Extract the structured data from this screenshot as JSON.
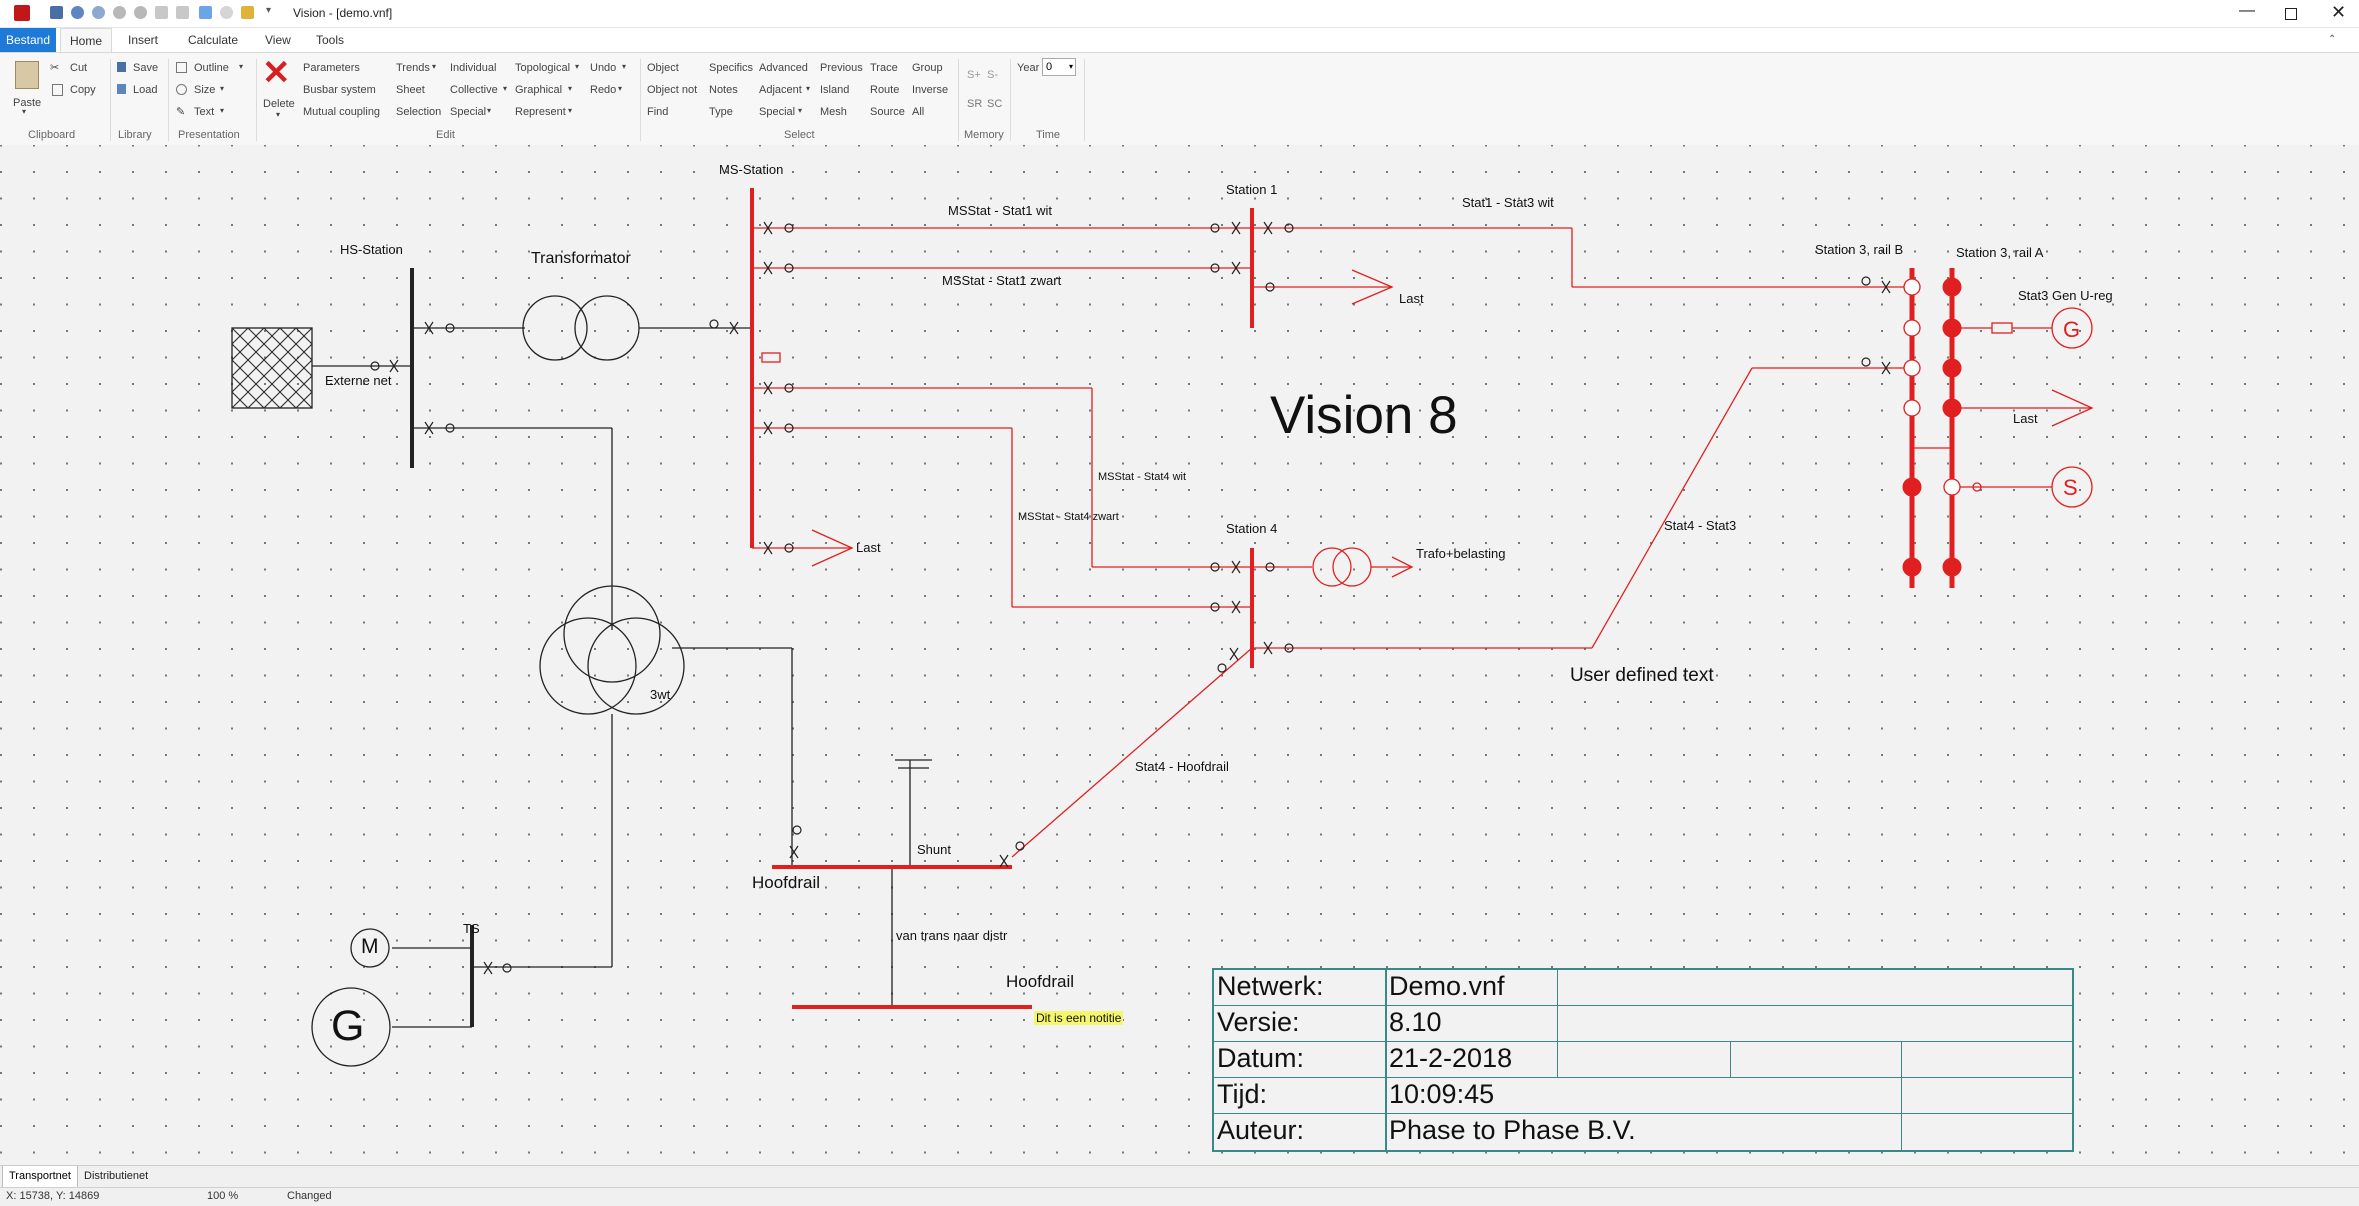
{
  "window": {
    "title": "Vision - [demo.vnf]"
  },
  "tabs": [
    "Bestand",
    "Home",
    "Insert",
    "Calculate",
    "View",
    "Tools"
  ],
  "ribbon": {
    "clipboard": {
      "paste": "Paste",
      "cut": "Cut",
      "copy": "Copy",
      "label": "Clipboard"
    },
    "library": {
      "save": "Save",
      "load": "Load",
      "label": "Library"
    },
    "presentation": {
      "outline": "Outline",
      "size": "Size",
      "text": "Text",
      "label": "Presentation"
    },
    "edit": {
      "delete": "Delete",
      "parameters": "Parameters",
      "busbar": "Busbar system",
      "mutual": "Mutual coupling",
      "trends": "Trends",
      "sheet": "Sheet",
      "selection": "Selection",
      "individual": "Individual",
      "collective": "Collective",
      "special": "Special",
      "topological": "Topological",
      "graphical": "Graphical",
      "represent": "Represent",
      "undo": "Undo",
      "redo": "Redo",
      "label": "Edit"
    },
    "select": {
      "object": "Object",
      "objectnot": "Object not",
      "find": "Find",
      "specifics": "Specifics",
      "notes": "Notes",
      "type": "Type",
      "advanced": "Advanced",
      "adjacent": "Adjacent",
      "special": "Special",
      "previous": "Previous",
      "island": "Island",
      "mesh": "Mesh",
      "trace": "Trace",
      "route": "Route",
      "source": "Source",
      "group": "Group",
      "inverse": "Inverse",
      "all": "All",
      "label": "Select"
    },
    "memory": {
      "splus": "S+",
      "sminus": "S-",
      "sr": "SR",
      "sc": "SC",
      "label": "Memory"
    },
    "time": {
      "year": "Year",
      "year_value": "0",
      "label": "Time"
    }
  },
  "diagram": {
    "labels": {
      "ms_station": "MS-Station",
      "hs_station": "HS-Station",
      "transformator": "Transformator",
      "externe_net": "Externe net",
      "station1": "Station 1",
      "station4": "Station 4",
      "stat1_stat3": "Stat1 - Stat3 wit",
      "station3b": "Station 3, rail B",
      "station3a": "Station 3, rail A",
      "gen_ureg": "Stat3 Gen U-reg",
      "mss_s1_wit": "MSStat - Stat1 wit",
      "mss_s1_zwart": "MSStat - Stat1 zwart",
      "last": "Last",
      "vision": "Vision 8",
      "mss_s4_wit": "MSStat - Stat4 wit",
      "mss_s4_zwart": "MSStat - Stat4 zwart",
      "stat4_stat3": "Stat4 - Stat3",
      "trafo": "Trafo+belasting",
      "user_text": "User defined text",
      "wt3": "3wt",
      "stat4_hoofd": "Stat4 - Hoofdrail",
      "shunt": "Shunt",
      "hoofdrail": "Hoofdrail",
      "van_trans": "van trans naar distr",
      "ts": "TS",
      "motor": "M",
      "gen": "G",
      "gen_sym": "G",
      "source_sym": "S",
      "note": "Dit is een notitie"
    },
    "title_block": [
      {
        "k": "Netwerk:",
        "v": "Demo.vnf"
      },
      {
        "k": "Versie:",
        "v": "8.10"
      },
      {
        "k": "Datum:",
        "v": "21-2-2018"
      },
      {
        "k": "Tijd:",
        "v": "10:09:45"
      },
      {
        "k": "Auteur:",
        "v": "Phase to Phase B.V."
      }
    ]
  },
  "doc_tabs": [
    "Transportnet",
    "Distributienet"
  ],
  "status": {
    "coords": "X: 15738, Y: 14869",
    "zoom": "100 %",
    "state": "Changed"
  },
  "colors": {
    "accent": "#1e7ad6",
    "network": "#e02020",
    "tab_text": "#a0282a",
    "grid": "#777777"
  }
}
